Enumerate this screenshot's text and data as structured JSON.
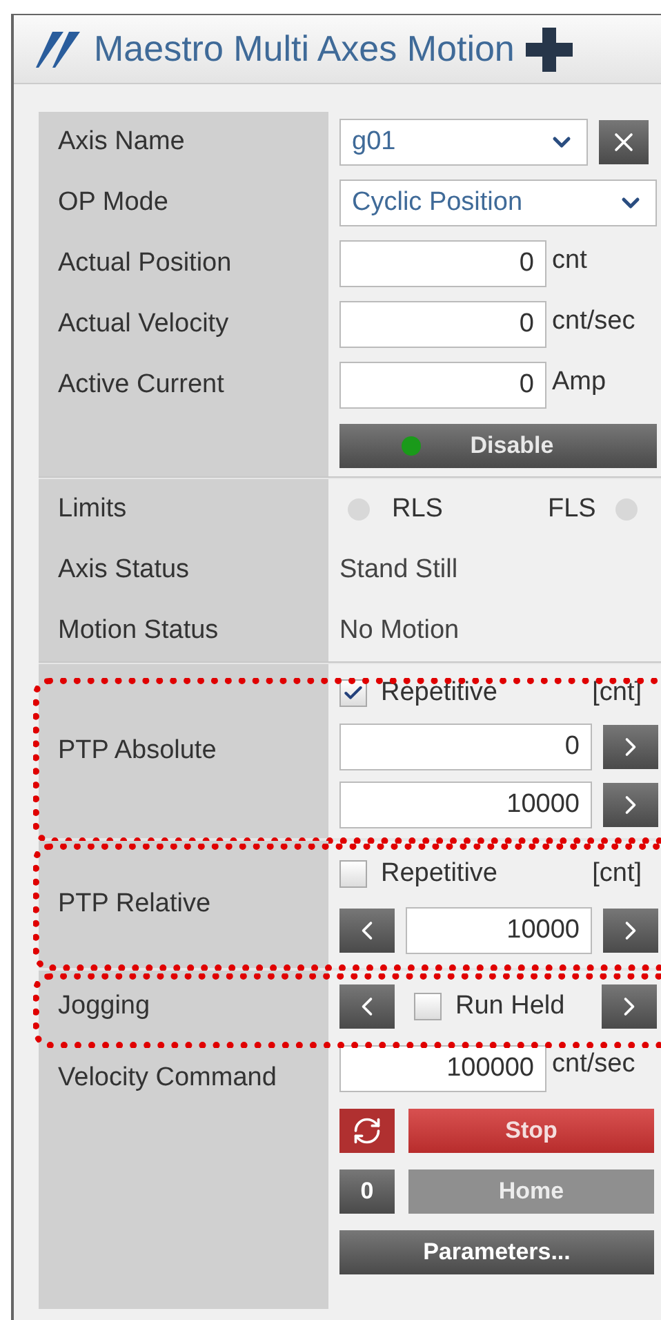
{
  "title": "Maestro Multi Axes Motion",
  "axis_name": {
    "label": "Axis Name",
    "value": "g01"
  },
  "op_mode": {
    "label": "OP Mode",
    "value": "Cyclic Position"
  },
  "readouts": [
    {
      "label": "Actual Position",
      "value": "0",
      "unit": "cnt"
    },
    {
      "label": "Actual Velocity",
      "value": "0",
      "unit": "cnt/sec"
    },
    {
      "label": "Active Current",
      "value": "0",
      "unit": "Amp"
    }
  ],
  "disable_button": {
    "label": "Disable",
    "led_on": true
  },
  "limits": {
    "label": "Limits",
    "rls": {
      "label": "RLS",
      "active": false
    },
    "fls": {
      "label": "FLS",
      "active": false
    }
  },
  "statuses": [
    {
      "label": "Axis Status",
      "value": "Stand Still"
    },
    {
      "label": "Motion Status",
      "value": "No Motion"
    }
  ],
  "ptp_absolute": {
    "label": "PTP Absolute",
    "highlighted": true,
    "repetitive": {
      "label": "Repetitive",
      "checked": true
    },
    "unit": "[cnt]",
    "targets": [
      "0",
      "10000"
    ]
  },
  "ptp_relative": {
    "label": "PTP Relative",
    "highlighted": true,
    "repetitive": {
      "label": "Repetitive",
      "checked": false
    },
    "unit": "[cnt]",
    "distance": "10000"
  },
  "jogging": {
    "label": "Jogging",
    "highlighted": true,
    "run_held": {
      "label": "Run Held",
      "checked": false
    }
  },
  "velocity_command": {
    "label": "Velocity Command",
    "value": "100000",
    "unit": "cnt/sec"
  },
  "stop_button": {
    "label": "Stop"
  },
  "home": {
    "index": "0",
    "label": "Home",
    "disabled": true
  },
  "parameters_button": {
    "label": "Parameters..."
  }
}
